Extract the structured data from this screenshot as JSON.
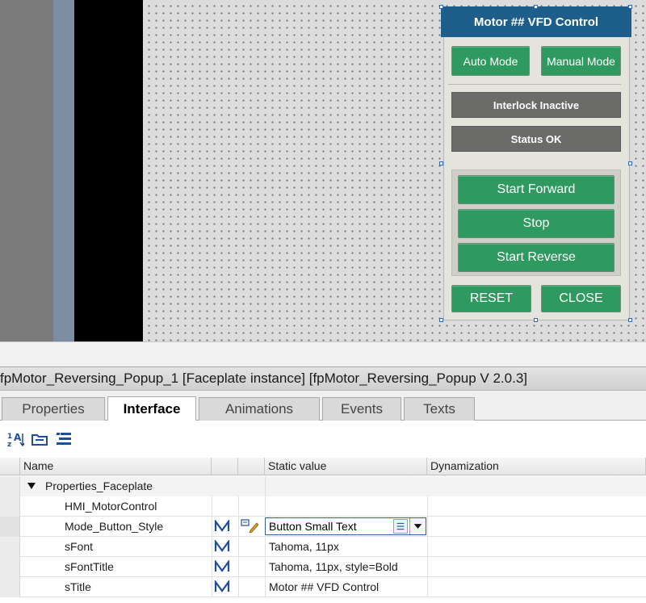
{
  "faceplate": {
    "title": "Motor ## VFD Control",
    "buttons": {
      "auto_mode": "Auto Mode",
      "manual_mode": "Manual Mode",
      "start_forward": "Start Forward",
      "stop": "Stop",
      "start_reverse": "Start Reverse",
      "reset": "RESET",
      "close": "CLOSE"
    },
    "status": {
      "interlock": "Interlock Inactive",
      "ok": "Status OK"
    },
    "colors": {
      "title_bar": "#1d5f8a",
      "button_green": "#2e9a5f",
      "status_gray": "#6b6c6a",
      "selection_handle": "#2b65c7"
    }
  },
  "inspector": {
    "title": "fpMotor_Reversing_Popup_1 [Faceplate instance] [fpMotor_Reversing_Popup V 2.0.3]",
    "tabs": [
      "Properties",
      "Interface",
      "Animations",
      "Events",
      "Texts"
    ],
    "active_tab": "Interface",
    "toolbar_icons": [
      "sort-icon",
      "folder-icon",
      "list-icon"
    ],
    "columns": {
      "name": "Name",
      "static_value": "Static value",
      "dynamization": "Dynamization"
    },
    "group": {
      "label": "Properties_Faceplate",
      "expanded": true
    },
    "rows": [
      {
        "name": "HMI_MotorControl",
        "value": ""
      },
      {
        "name": "Mode_Button_Style",
        "value": "Button Small Text",
        "editing": true
      },
      {
        "name": "sFont",
        "value": "Tahoma, 11px"
      },
      {
        "name": "sFontTitle",
        "value": "Tahoma, 11px, style=Bold"
      },
      {
        "name": "sTitle",
        "value": "Motor ## VFD Control"
      }
    ]
  }
}
